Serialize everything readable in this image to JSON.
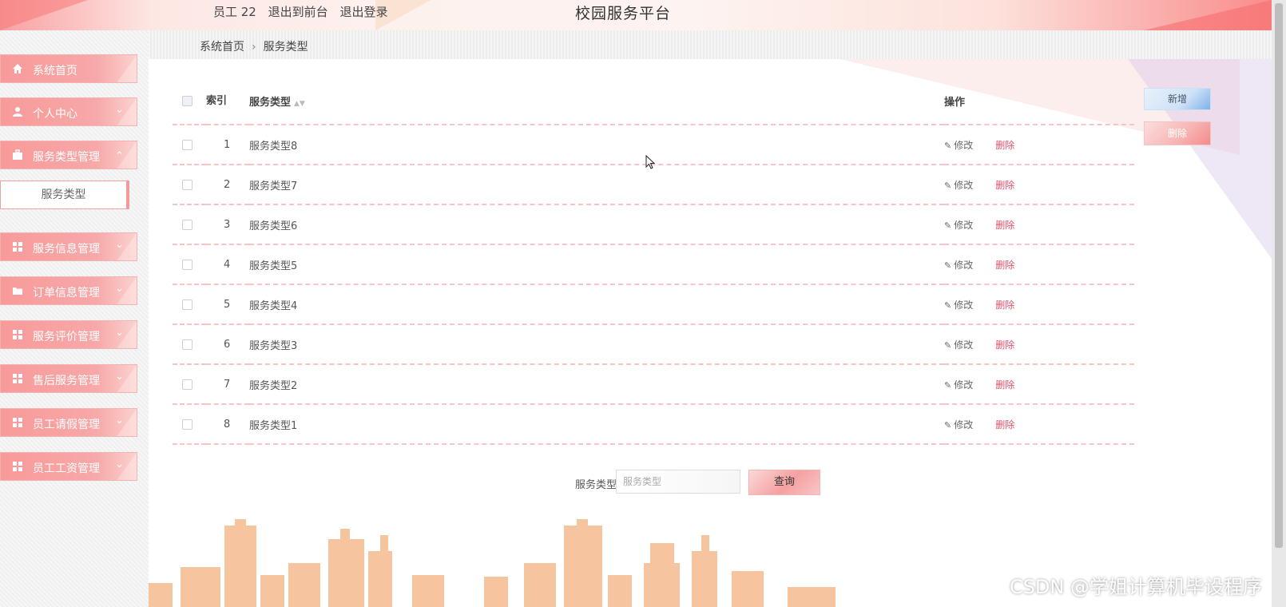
{
  "header": {
    "user_label": "员工 22",
    "front_link": "退出到前台",
    "logout_link": "退出登录",
    "site_title": "校园服务平台"
  },
  "sidebar": {
    "items": [
      {
        "label": "系统首页",
        "icon": "home-icon"
      },
      {
        "label": "个人中心",
        "icon": "user-icon"
      },
      {
        "label": "服务类型管理",
        "icon": "briefcase-icon",
        "expanded": true,
        "children": [
          {
            "label": "服务类型"
          }
        ]
      },
      {
        "label": "服务信息管理",
        "icon": "grid-icon"
      },
      {
        "label": "订单信息管理",
        "icon": "folder-icon"
      },
      {
        "label": "服务评价管理",
        "icon": "grid-icon"
      },
      {
        "label": "售后服务管理",
        "icon": "grid-icon"
      },
      {
        "label": "员工请假管理",
        "icon": "grid-icon"
      },
      {
        "label": "员工工资管理",
        "icon": "grid-icon"
      }
    ]
  },
  "breadcrumb": {
    "home": "系统首页",
    "current": "服务类型"
  },
  "table": {
    "headers": {
      "seq": "索引",
      "name": "服务类型",
      "ops": "操作"
    },
    "rows": [
      {
        "no": "1",
        "name": "服务类型8"
      },
      {
        "no": "2",
        "name": "服务类型7"
      },
      {
        "no": "3",
        "name": "服务类型6"
      },
      {
        "no": "4",
        "name": "服务类型5"
      },
      {
        "no": "5",
        "name": "服务类型4"
      },
      {
        "no": "6",
        "name": "服务类型3"
      },
      {
        "no": "7",
        "name": "服务类型2"
      },
      {
        "no": "8",
        "name": "服务类型1"
      }
    ],
    "edit_label": "修改",
    "delete_label": "删除"
  },
  "actions": {
    "add_label": "新增",
    "delete_label": "删除"
  },
  "search": {
    "label": "服务类型",
    "placeholder": "服务类型",
    "button_label": "查询"
  },
  "watermark": "CSDN @学姐计算机毕设程序",
  "colors": {
    "accent": "#f7a8a8",
    "danger_text": "#e0506a",
    "add_button": "#7fb2ea"
  }
}
